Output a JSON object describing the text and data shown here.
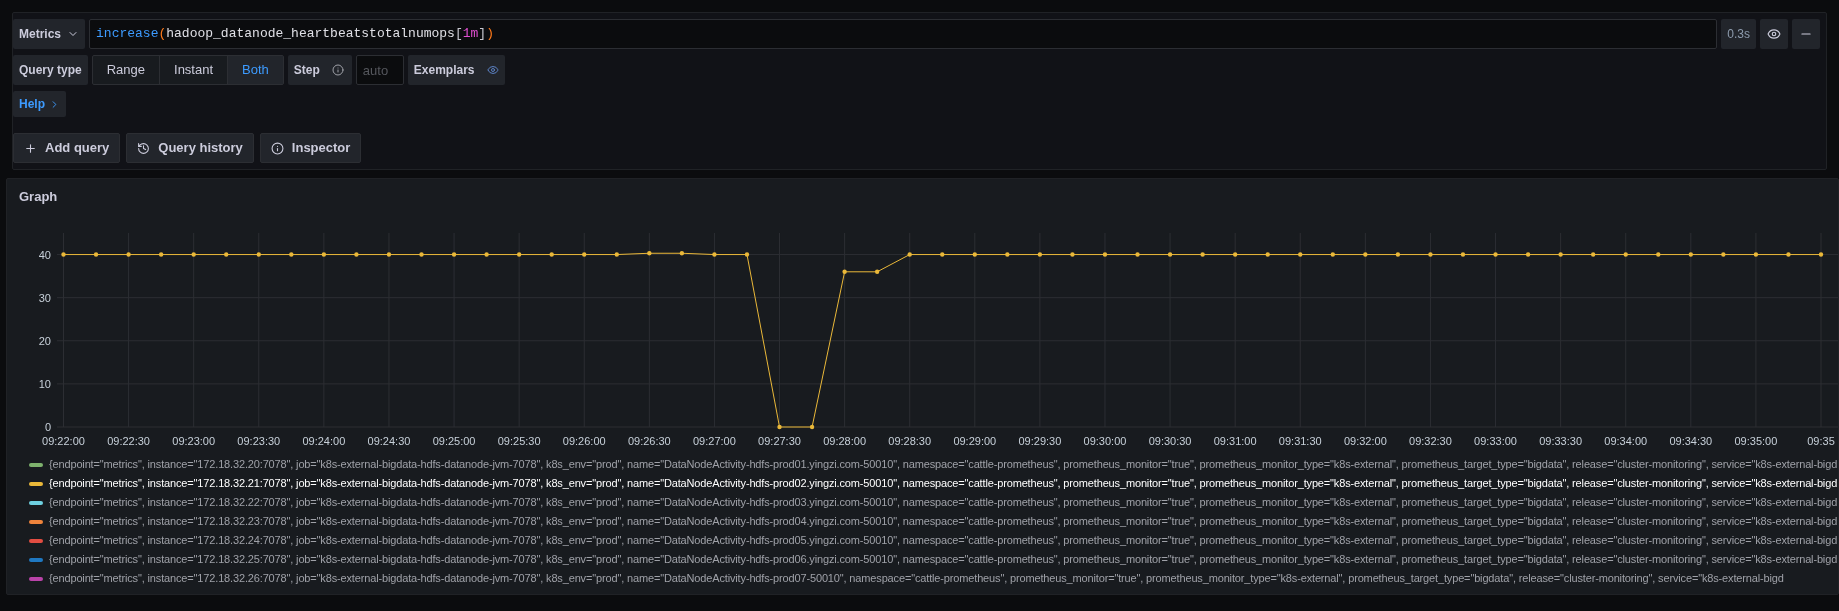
{
  "query_editor": {
    "datasource_button": "Metrics",
    "query_tokens": [
      {
        "text": "increase",
        "kind": "function"
      },
      {
        "text": "(",
        "kind": "paren"
      },
      {
        "text": "hadoop_datanode_heartbeatstotalnumops",
        "kind": "metric"
      },
      {
        "text": "[",
        "kind": "bracket"
      },
      {
        "text": "1m",
        "kind": "duration"
      },
      {
        "text": "]",
        "kind": "bracket"
      },
      {
        "text": ")",
        "kind": "paren"
      }
    ],
    "query_time": "0.3s",
    "query_type_label": "Query type",
    "query_types": [
      {
        "label": "Range",
        "selected": false
      },
      {
        "label": "Instant",
        "selected": false
      },
      {
        "label": "Both",
        "selected": true
      }
    ],
    "step_label": "Step",
    "step_placeholder": "auto",
    "exemplars_label": "Exemplars",
    "help_link": "Help"
  },
  "actions": [
    {
      "label": "Add query",
      "kind": "add"
    },
    {
      "label": "Query history",
      "kind": "history"
    },
    {
      "label": "Inspector",
      "kind": "info"
    }
  ],
  "graph": {
    "title": "Graph",
    "chart_data": {
      "type": "line",
      "categories": [
        "09:22:00",
        null,
        "09:22:30",
        null,
        "09:23:00",
        null,
        "09:23:30",
        null,
        "09:24:00",
        null,
        "09:24:30",
        null,
        "09:25:00",
        null,
        "09:25:30",
        null,
        "09:26:00",
        null,
        "09:26:30",
        null,
        "09:27:00",
        null,
        "09:27:30",
        null,
        "09:28:00",
        null,
        "09:28:30",
        null,
        "09:29:00",
        null,
        "09:29:30",
        null,
        "09:30:00",
        null,
        "09:30:30",
        null,
        "09:31:00",
        null,
        "09:31:30",
        null,
        "09:32:00",
        null,
        "09:32:30",
        null,
        "09:33:00",
        null,
        "09:33:30",
        null,
        "09:34:00",
        null,
        "09:34:30",
        null,
        "09:35:00",
        null,
        "09:35"
      ],
      "series": [
        {
          "color": "#eab839",
          "values": [
            40,
            40,
            40,
            40,
            40,
            40,
            40,
            40,
            40,
            40,
            40,
            40,
            40,
            40,
            40,
            40,
            40,
            40,
            40.3,
            40.3,
            40,
            40,
            0,
            0,
            36,
            36,
            40,
            40,
            40,
            40,
            40,
            40,
            40,
            40,
            40,
            40,
            40,
            40,
            40,
            40,
            40,
            40,
            40,
            40,
            40,
            40,
            40,
            40,
            40,
            40,
            40,
            40,
            40,
            40,
            40
          ]
        }
      ],
      "ylim": [
        0,
        45
      ],
      "yticks": [
        0,
        10,
        20,
        30,
        40
      ],
      "grid": true
    },
    "legend": [
      {
        "text": "{endpoint=\"metrics\", instance=\"172.18.32.20:7078\", job=\"k8s-external-bigdata-hdfs-datanode-jvm-7078\", k8s_env=\"prod\", name=\"DataNodeActivity-hdfs-prod01.yingzi.com-50010\", namespace=\"cattle-prometheus\", prometheus_monitor=\"true\", prometheus_monitor_type=\"k8s-external\", prometheus_target_type=\"bigdata\", release=\"cluster-monitoring\", service=\"k8s-external-bigd",
        "color": "#7eb26d",
        "selected": false
      },
      {
        "text": "{endpoint=\"metrics\", instance=\"172.18.32.21:7078\", job=\"k8s-external-bigdata-hdfs-datanode-jvm-7078\", k8s_env=\"prod\", name=\"DataNodeActivity-hdfs-prod02.yingzi.com-50010\", namespace=\"cattle-prometheus\", prometheus_monitor=\"true\", prometheus_monitor_type=\"k8s-external\", prometheus_target_type=\"bigdata\", release=\"cluster-monitoring\", service=\"k8s-external-bigd",
        "color": "#eab839",
        "selected": true
      },
      {
        "text": "{endpoint=\"metrics\", instance=\"172.18.32.22:7078\", job=\"k8s-external-bigdata-hdfs-datanode-jvm-7078\", k8s_env=\"prod\", name=\"DataNodeActivity-hdfs-prod03.yingzi.com-50010\", namespace=\"cattle-prometheus\", prometheus_monitor=\"true\", prometheus_monitor_type=\"k8s-external\", prometheus_target_type=\"bigdata\", release=\"cluster-monitoring\", service=\"k8s-external-bigd",
        "color": "#6ed0e0",
        "selected": false
      },
      {
        "text": "{endpoint=\"metrics\", instance=\"172.18.32.23:7078\", job=\"k8s-external-bigdata-hdfs-datanode-jvm-7078\", k8s_env=\"prod\", name=\"DataNodeActivity-hdfs-prod04.yingzi.com-50010\", namespace=\"cattle-prometheus\", prometheus_monitor=\"true\", prometheus_monitor_type=\"k8s-external\", prometheus_target_type=\"bigdata\", release=\"cluster-monitoring\", service=\"k8s-external-bigd",
        "color": "#ef843c",
        "selected": false
      },
      {
        "text": "{endpoint=\"metrics\", instance=\"172.18.32.24:7078\", job=\"k8s-external-bigdata-hdfs-datanode-jvm-7078\", k8s_env=\"prod\", name=\"DataNodeActivity-hdfs-prod05.yingzi.com-50010\", namespace=\"cattle-prometheus\", prometheus_monitor=\"true\", prometheus_monitor_type=\"k8s-external\", prometheus_target_type=\"bigdata\", release=\"cluster-monitoring\", service=\"k8s-external-bigd",
        "color": "#e24d42",
        "selected": false
      },
      {
        "text": "{endpoint=\"metrics\", instance=\"172.18.32.25:7078\", job=\"k8s-external-bigdata-hdfs-datanode-jvm-7078\", k8s_env=\"prod\", name=\"DataNodeActivity-hdfs-prod06.yingzi.com-50010\", namespace=\"cattle-prometheus\", prometheus_monitor=\"true\", prometheus_monitor_type=\"k8s-external\", prometheus_target_type=\"bigdata\", release=\"cluster-monitoring\", service=\"k8s-external-bigd",
        "color": "#1f78c1",
        "selected": false
      },
      {
        "text": "{endpoint=\"metrics\", instance=\"172.18.32.26:7078\", job=\"k8s-external-bigdata-hdfs-datanode-jvm-7078\", k8s_env=\"prod\", name=\"DataNodeActivity-hdfs-prod07-50010\", namespace=\"cattle-prometheus\", prometheus_monitor=\"true\", prometheus_monitor_type=\"k8s-external\", prometheus_target_type=\"bigdata\", release=\"cluster-monitoring\", service=\"k8s-external-bigd",
        "color": "#ba43a9",
        "selected": false
      }
    ]
  }
}
